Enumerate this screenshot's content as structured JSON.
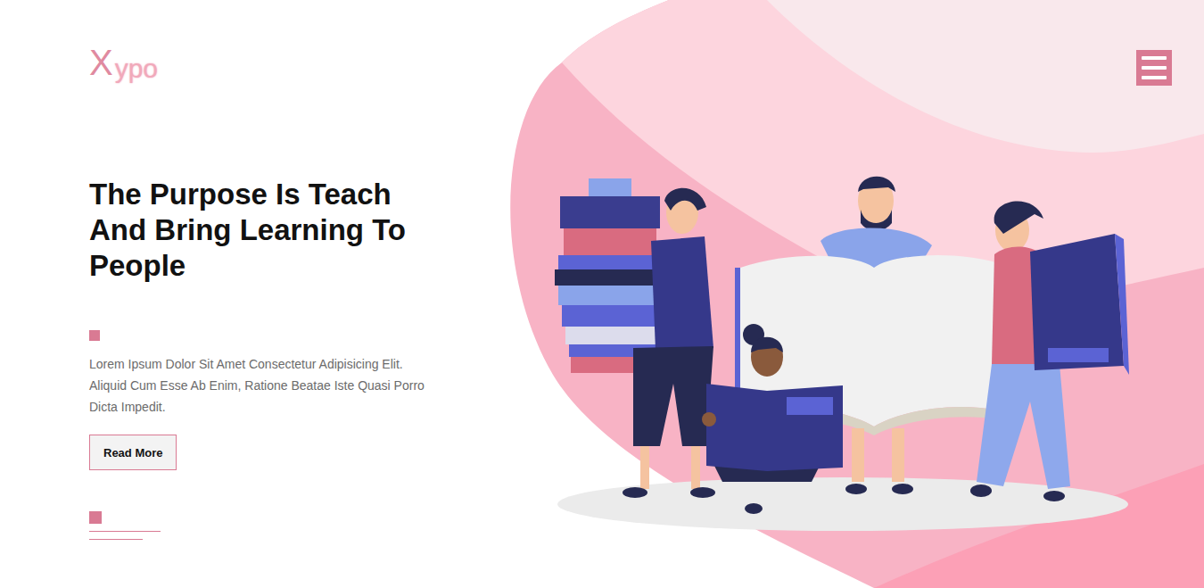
{
  "logo": {
    "first": "X",
    "rest": "ypo"
  },
  "hero": {
    "title": "The Purpose Is Teach And Bring Learning To People",
    "description": "Lorem Ipsum Dolor Sit Amet Consectetur Adipisicing Elit. Aliquid Cum Esse Ab Enim, Ratione Beatae Iste Quasi Porro Dicta Impedit.",
    "button": "Read More"
  }
}
